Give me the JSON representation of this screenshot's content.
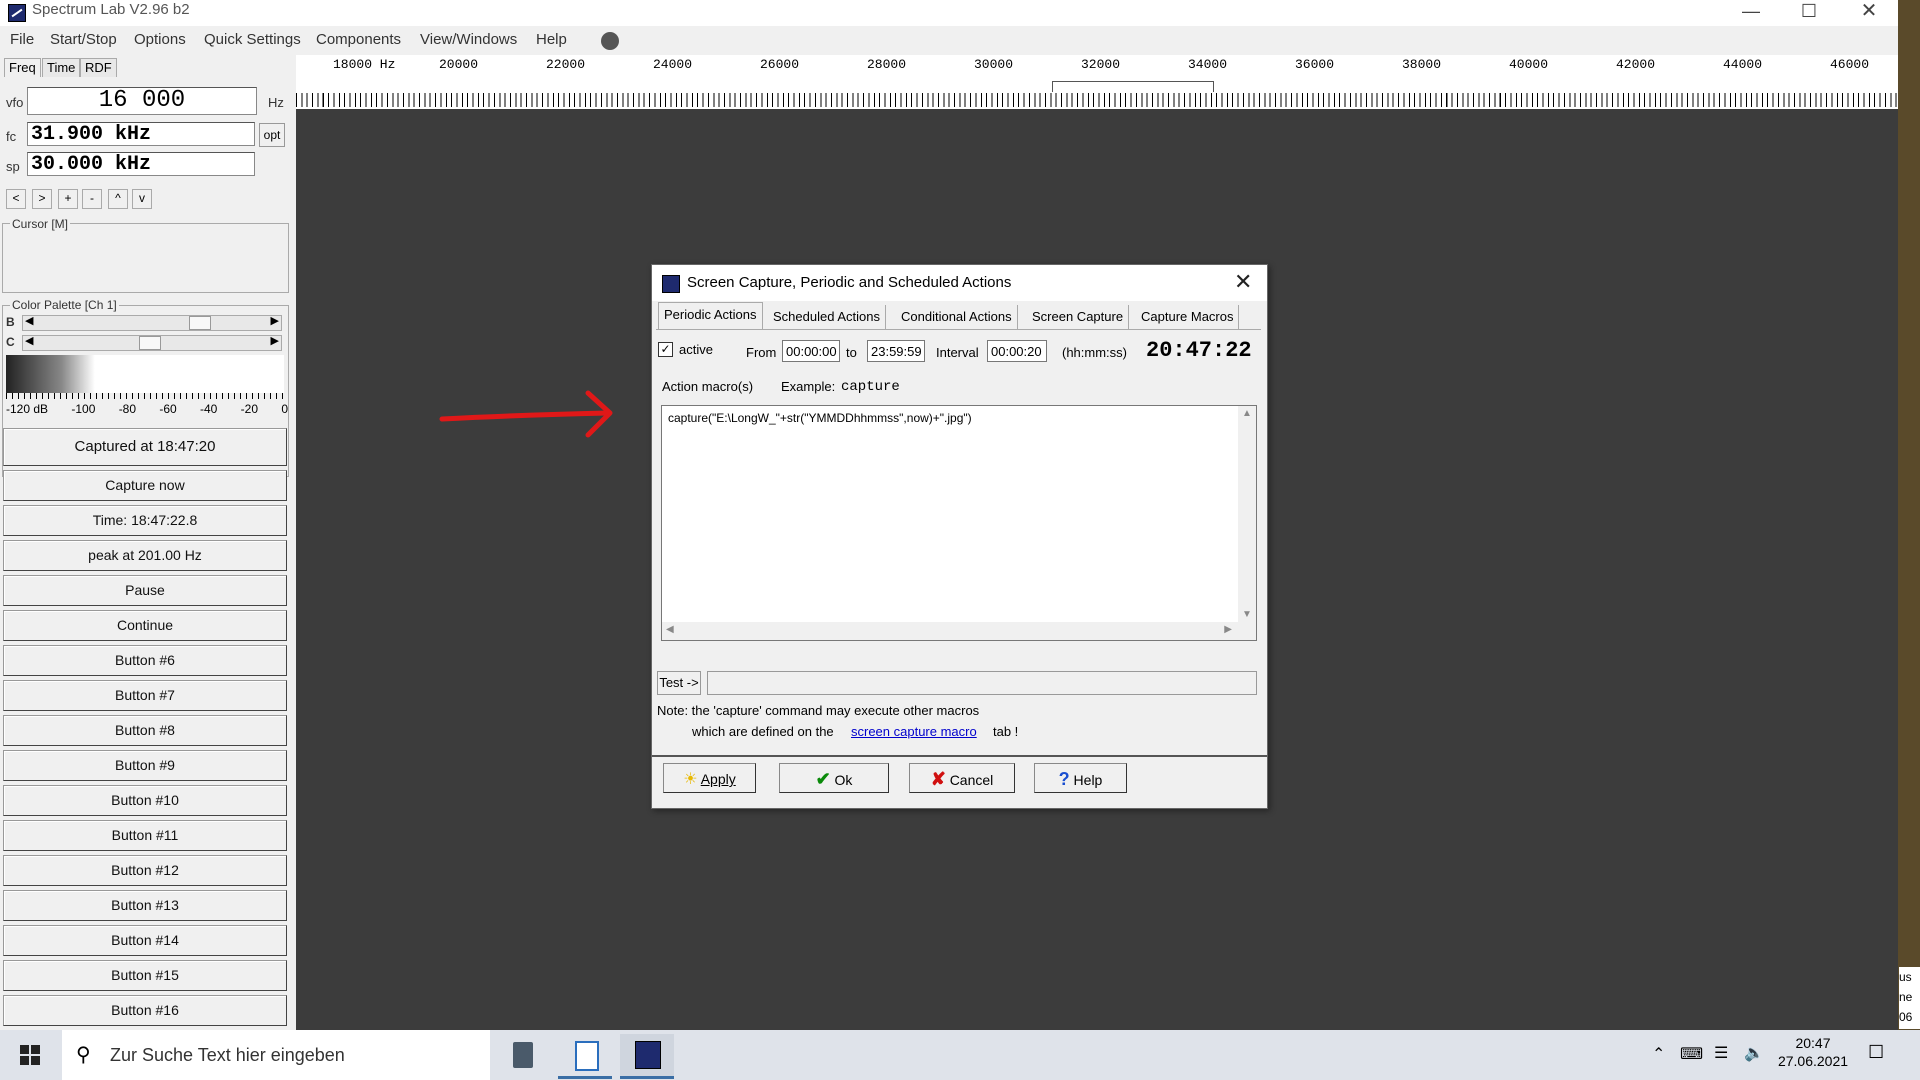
{
  "window": {
    "title": "Spectrum Lab V2.96 b2"
  },
  "menu": [
    "File",
    "Start/Stop",
    "Options",
    "Quick Settings",
    "Components",
    "View/Windows",
    "Help"
  ],
  "left": {
    "tabs": [
      "Freq",
      "Time",
      "RDF"
    ],
    "vfo_label": "vfo",
    "vfo_value": "16 000",
    "vfo_unit": "Hz",
    "fc_label": "fc",
    "fc_value": "31.900 kHz",
    "opt_label": "opt",
    "sp_label": "sp",
    "sp_value": "30.000 kHz",
    "nav_buttons": [
      "<",
      ">",
      "+",
      "-",
      "^",
      "v"
    ],
    "cursor_label": "Cursor  [M]",
    "palette_label": "Color Palette [Ch 1]",
    "b_label": "B",
    "c_label": "C",
    "db_scale": [
      "-120 dB",
      "-100",
      "-80",
      "-60",
      "-40",
      "-20",
      "0"
    ],
    "buttons": [
      "Captured at 18:47:20",
      "Capture now",
      "Time:  18:47:22.8",
      "peak at 201.00 Hz",
      "Pause",
      "Continue",
      "Button #6",
      "Button #7",
      "Button #8",
      "Button #9",
      "Button #10",
      "Button #11",
      "Button #12",
      "Button #13",
      "Button #14",
      "Button #15",
      "Button #16"
    ]
  },
  "scale": {
    "labels": [
      "18000 Hz",
      "20000",
      "22000",
      "24000",
      "26000",
      "28000",
      "30000",
      "32000",
      "34000",
      "36000",
      "38000",
      "40000",
      "42000",
      "44000",
      "46000"
    ]
  },
  "dialog": {
    "title": "Screen Capture, Periodic and Scheduled Actions",
    "tabs": [
      "Periodic Actions",
      "Scheduled Actions",
      "Conditional Actions",
      "Screen Capture",
      "Capture Macros"
    ],
    "active_label": "active",
    "active_checked": true,
    "from_label": "From",
    "from_value": "00:00:00",
    "to_label": "to",
    "to_value": "23:59:59",
    "interval_label": "Interval",
    "interval_value": "00:00:20",
    "format_label": "(hh:mm:ss)",
    "clock": "20:47:22",
    "action_label": "Action macro(s)",
    "example_label": "Example:",
    "example_value": "capture",
    "macro_text": "capture(\"E:\\LongW_\"+str(\"YMMDDhhmmss\",now)+\".jpg\")",
    "test_label": "Test ->",
    "test_result": "",
    "note_line1": "Note: the 'capture' command  may  execute other macros",
    "note_line2_prefix": "which are defined on the",
    "note_link": "screen capture macro",
    "note_line2_suffix": "tab !",
    "buttons": {
      "apply": "Apply",
      "ok": "Ok",
      "cancel": "Cancel",
      "help": "Help"
    }
  },
  "taskbar": {
    "search_placeholder": "Zur Suche Text hier eingeben",
    "time": "20:47",
    "date": "27.06.2021"
  },
  "edge_text": [
    "us",
    "ne",
    "06"
  ]
}
